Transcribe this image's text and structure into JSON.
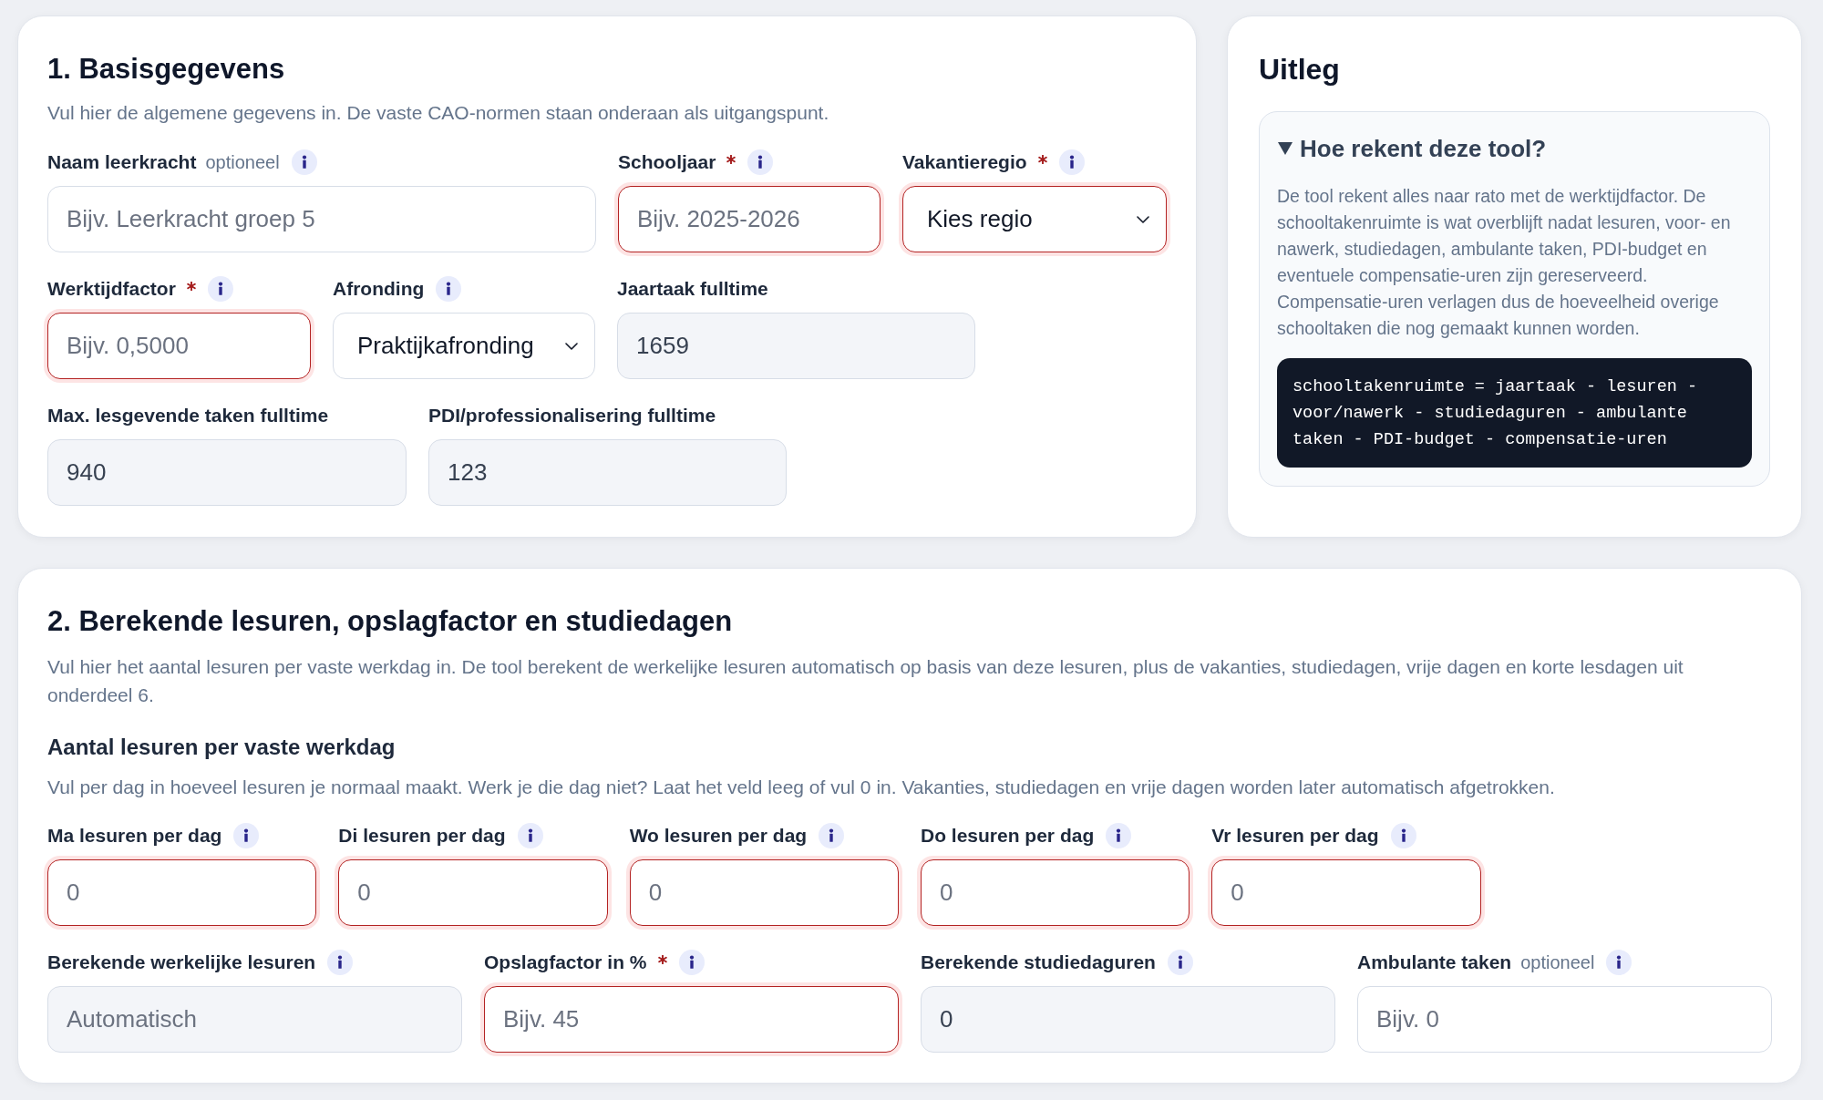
{
  "basisgegevens": {
    "title": "1. Basisgegevens",
    "description": "Vul hier de algemene gegevens in. De vaste CAO-normen staan onderaan als uitgangspunt.",
    "fields": [
      {
        "label": "Naam leerkracht",
        "hint": "optioneel",
        "required": false,
        "info": true,
        "kind": "input",
        "placeholder": "Bijv. Leerkracht groep 5",
        "error": false,
        "readonly": false
      },
      {
        "label": "Schooljaar",
        "required": true,
        "info": true,
        "kind": "input",
        "placeholder": "Bijv. 2025-2026",
        "error": true,
        "readonly": false
      },
      {
        "label": "Vakantieregio",
        "required": true,
        "info": true,
        "kind": "select",
        "value": "Kies regio",
        "error": true,
        "readonly": false
      },
      {
        "label": "Werktijdfactor",
        "required": true,
        "info": true,
        "kind": "input",
        "placeholder": "Bijv. 0,5000",
        "error": true,
        "readonly": false
      },
      {
        "label": "Afronding",
        "required": false,
        "info": true,
        "kind": "select",
        "value": "Praktijkafronding",
        "error": false,
        "readonly": false
      },
      {
        "label": "Jaartaak fulltime",
        "required": false,
        "info": false,
        "kind": "input",
        "value": "1659",
        "error": false,
        "readonly": true
      },
      {
        "label": "Max. lesgevende taken fulltime",
        "required": false,
        "info": false,
        "kind": "input",
        "value": "940",
        "error": false,
        "readonly": true
      },
      {
        "label": "PDI/professionalisering fulltime",
        "required": false,
        "info": false,
        "kind": "input",
        "value": "123",
        "error": false,
        "readonly": true
      }
    ]
  },
  "uitleg": {
    "title": "Uitleg",
    "details": {
      "summary": "Hoe rekent deze tool?",
      "expanded": true,
      "text": "De tool rekent alles naar rato met de werktijdfactor. De schooltakenruimte is wat overblijft nadat lesuren, voor- en nawerk, studiedagen, ambulante taken, PDI-budget en eventuele compensatie-uren zijn gereserveerd. Compensatie-uren verlagen dus de hoeveelheid overige schooltaken die nog gemaakt kunnen worden.",
      "code": "schooltakenruimte = jaartaak - lesuren - voor/nawerk - studiedaguren - ambulante taken - PDI-budget - compensatie-uren"
    }
  },
  "lesuren": {
    "title": "2. Berekende lesuren, opslagfactor en studiedagen",
    "description": "Vul hier het aantal lesuren per vaste werkdag in. De tool berekent de werkelijke lesuren automatisch op basis van deze lesuren, plus de vakanties, studiedagen, vrije dagen en korte lesdagen uit onderdeel 6.",
    "subsection": {
      "title": "Aantal lesuren per vaste werkdag",
      "description": "Vul per dag in hoeveel lesuren je normaal maakt. Werk je die dag niet? Laat het veld leeg of vul 0 in. Vakanties, studiedagen en vrije dagen worden later automatisch afgetrokken."
    },
    "day_fields": [
      {
        "label": "Ma lesuren per dag",
        "required": false,
        "info": true,
        "kind": "input",
        "placeholder": "0",
        "error": true,
        "readonly": false
      },
      {
        "label": "Di lesuren per dag",
        "required": false,
        "info": true,
        "kind": "input",
        "placeholder": "0",
        "error": true,
        "readonly": false
      },
      {
        "label": "Wo lesuren per dag",
        "required": false,
        "info": true,
        "kind": "input",
        "placeholder": "0",
        "error": true,
        "readonly": false
      },
      {
        "label": "Do lesuren per dag",
        "required": false,
        "info": true,
        "kind": "input",
        "placeholder": "0",
        "error": true,
        "readonly": false
      },
      {
        "label": "Vr lesuren per dag",
        "required": false,
        "info": true,
        "kind": "input",
        "placeholder": "0",
        "error": true,
        "readonly": false
      }
    ],
    "fields": [
      {
        "label": "Berekende werkelijke lesuren",
        "required": false,
        "info": true,
        "kind": "input",
        "placeholder": "Automatisch",
        "error": false,
        "readonly": true
      },
      {
        "label": "Opslagfactor in %",
        "required": true,
        "info": true,
        "kind": "input",
        "placeholder": "Bijv. 45",
        "error": true,
        "readonly": false
      },
      {
        "label": "Berekende studiedaguren",
        "required": false,
        "info": true,
        "kind": "input",
        "value": "0",
        "error": false,
        "readonly": true
      },
      {
        "label": "Ambulante taken",
        "hint": "optioneel",
        "required": false,
        "info": true,
        "kind": "input",
        "placeholder": "Bijv. 0",
        "error": false,
        "readonly": false
      }
    ]
  }
}
